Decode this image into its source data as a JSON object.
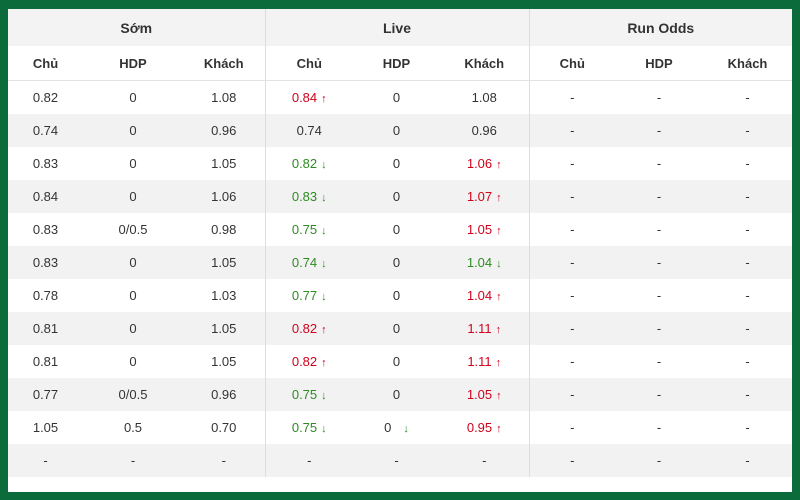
{
  "groups": {
    "early": "Sớm",
    "live": "Live",
    "run": "Run Odds"
  },
  "subheaders": {
    "home": "Chủ",
    "hdp": "HDP",
    "away": "Khách"
  },
  "colors": {
    "up": "#d0021b",
    "down": "#2e8b22",
    "frame": "#0b6b3a"
  },
  "rows": [
    {
      "early": [
        "0.82",
        "0",
        "1.08"
      ],
      "live": [
        {
          "v": "0.84",
          "dir": "up"
        },
        {
          "v": "0",
          "dir": ""
        },
        {
          "v": "1.08",
          "dir": ""
        }
      ],
      "run": [
        "-",
        "-",
        "-"
      ]
    },
    {
      "early": [
        "0.74",
        "0",
        "0.96"
      ],
      "live": [
        {
          "v": "0.74",
          "dir": ""
        },
        {
          "v": "0",
          "dir": ""
        },
        {
          "v": "0.96",
          "dir": ""
        }
      ],
      "run": [
        "-",
        "-",
        "-"
      ]
    },
    {
      "early": [
        "0.83",
        "0",
        "1.05"
      ],
      "live": [
        {
          "v": "0.82",
          "dir": "down"
        },
        {
          "v": "0",
          "dir": ""
        },
        {
          "v": "1.06",
          "dir": "up"
        }
      ],
      "run": [
        "-",
        "-",
        "-"
      ]
    },
    {
      "early": [
        "0.84",
        "0",
        "1.06"
      ],
      "live": [
        {
          "v": "0.83",
          "dir": "down"
        },
        {
          "v": "0",
          "dir": ""
        },
        {
          "v": "1.07",
          "dir": "up"
        }
      ],
      "run": [
        "-",
        "-",
        "-"
      ]
    },
    {
      "early": [
        "0.83",
        "0/0.5",
        "0.98"
      ],
      "live": [
        {
          "v": "0.75",
          "dir": "down"
        },
        {
          "v": "0",
          "dir": ""
        },
        {
          "v": "1.05",
          "dir": "up"
        }
      ],
      "run": [
        "-",
        "-",
        "-"
      ]
    },
    {
      "early": [
        "0.83",
        "0",
        "1.05"
      ],
      "live": [
        {
          "v": "0.74",
          "dir": "down"
        },
        {
          "v": "0",
          "dir": ""
        },
        {
          "v": "1.04",
          "dir": "down"
        }
      ],
      "run": [
        "-",
        "-",
        "-"
      ]
    },
    {
      "early": [
        "0.78",
        "0",
        "1.03"
      ],
      "live": [
        {
          "v": "0.77",
          "dir": "down"
        },
        {
          "v": "0",
          "dir": ""
        },
        {
          "v": "1.04",
          "dir": "up"
        }
      ],
      "run": [
        "-",
        "-",
        "-"
      ]
    },
    {
      "early": [
        "0.81",
        "0",
        "1.05"
      ],
      "live": [
        {
          "v": "0.82",
          "dir": "up"
        },
        {
          "v": "0",
          "dir": ""
        },
        {
          "v": "1.11",
          "dir": "up"
        }
      ],
      "run": [
        "-",
        "-",
        "-"
      ]
    },
    {
      "early": [
        "0.81",
        "0",
        "1.05"
      ],
      "live": [
        {
          "v": "0.82",
          "dir": "up"
        },
        {
          "v": "0",
          "dir": ""
        },
        {
          "v": "1.11",
          "dir": "up"
        }
      ],
      "run": [
        "-",
        "-",
        "-"
      ]
    },
    {
      "early": [
        "0.77",
        "0/0.5",
        "0.96"
      ],
      "live": [
        {
          "v": "0.75",
          "dir": "down"
        },
        {
          "v": "0",
          "dir": ""
        },
        {
          "v": "1.05",
          "dir": "up"
        }
      ],
      "run": [
        "-",
        "-",
        "-"
      ]
    },
    {
      "early": [
        "1.05",
        "0.5",
        "0.70"
      ],
      "live": [
        {
          "v": "0.75",
          "dir": "down"
        },
        {
          "v": "0",
          "dir": "down"
        },
        {
          "v": "0.95",
          "dir": "up"
        }
      ],
      "run": [
        "-",
        "-",
        "-"
      ]
    },
    {
      "early": [
        "-",
        "-",
        "-"
      ],
      "live": [
        {
          "v": "-",
          "dir": ""
        },
        {
          "v": "-",
          "dir": ""
        },
        {
          "v": "-",
          "dir": ""
        }
      ],
      "run": [
        "-",
        "-",
        "-"
      ]
    }
  ]
}
